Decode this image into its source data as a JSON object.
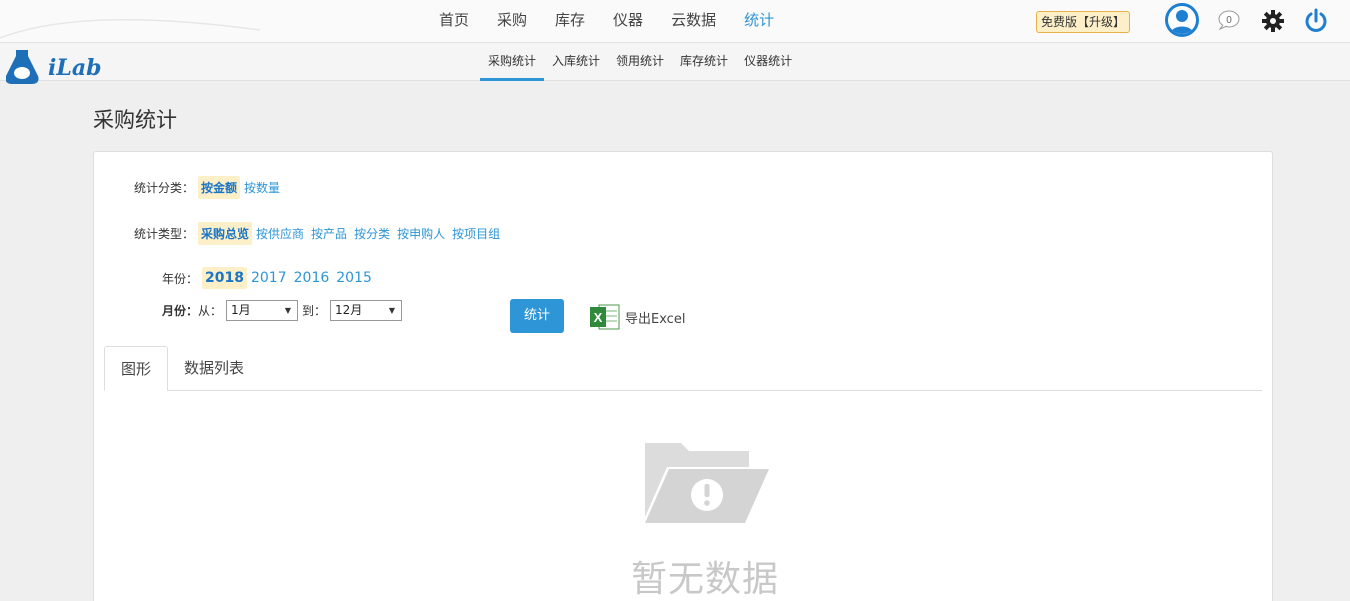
{
  "header": {
    "nav": [
      "首页",
      "采购",
      "库存",
      "仪器",
      "云数据",
      "统计"
    ],
    "active_nav": "统计",
    "plan_badge": "免费版【升级】",
    "message_count": "0"
  },
  "logo": {
    "text": "iLab"
  },
  "subnav": {
    "items": [
      "采购统计",
      "入库统计",
      "领用统计",
      "库存统计",
      "仪器统计"
    ],
    "active": "采购统计"
  },
  "page": {
    "title": "采购统计"
  },
  "filters": {
    "category_label": "统计分类：",
    "category_options": [
      "按金额",
      "按数量"
    ],
    "type_label": "统计类型：",
    "type_options": [
      "采购总览",
      "按供应商",
      "按产品",
      "按分类",
      "按申购人",
      "按项目组"
    ],
    "year_label": "年份：",
    "years": [
      "2018",
      "2017",
      "2016",
      "2015"
    ],
    "month_label": "月份：",
    "from_label": "从：",
    "from_value": "1月",
    "to_label": "到：",
    "to_value": "12月"
  },
  "actions": {
    "stat_button": "统计",
    "export_label": "导出Excel"
  },
  "tabs": [
    "图形",
    "数据列表"
  ],
  "empty": {
    "text": "暂无数据"
  },
  "colors": {
    "accent": "#2e95d6",
    "highlight": "#fdf0c8",
    "empty": "#c8c8c8"
  }
}
